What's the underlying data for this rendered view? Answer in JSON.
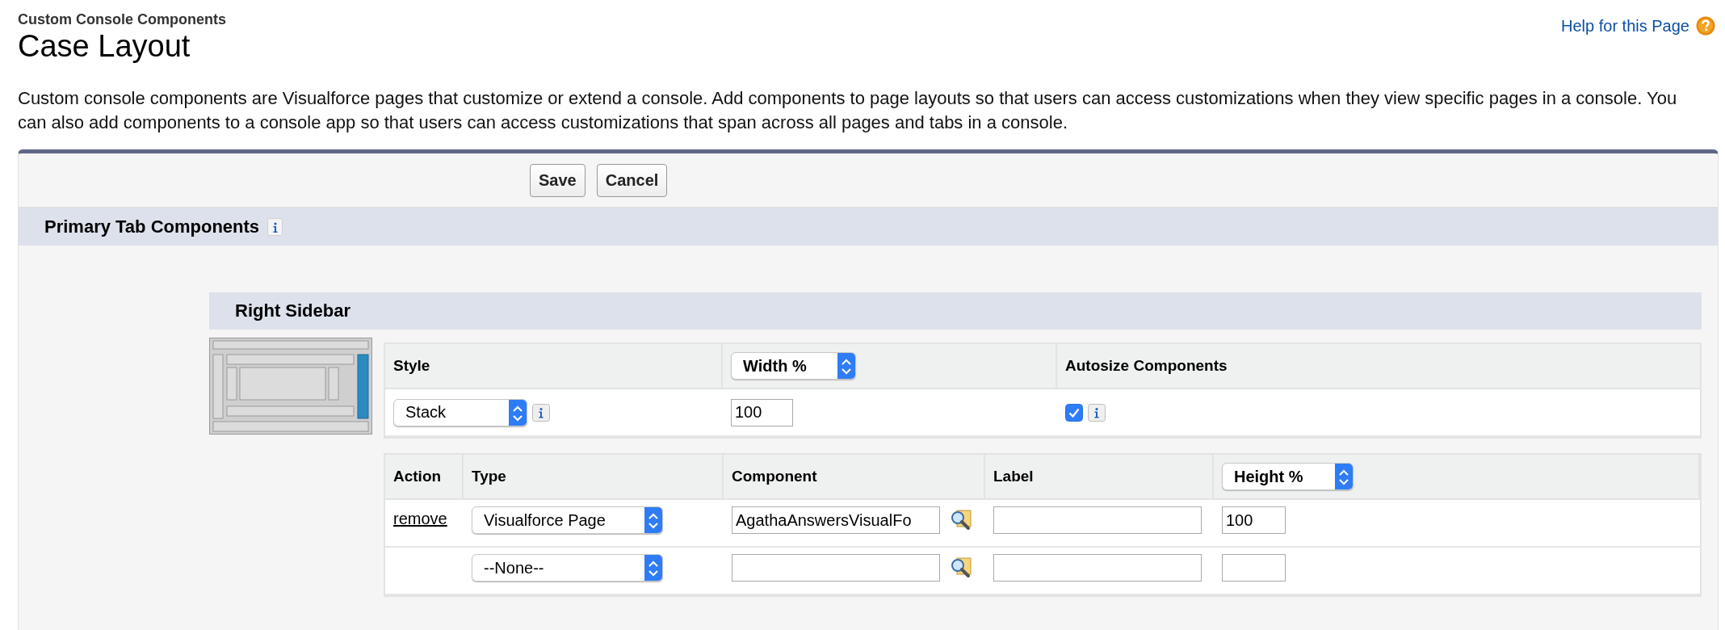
{
  "header": {
    "breadcrumb": "Custom Console Components",
    "title": "Case Layout",
    "help_link": "Help for this Page"
  },
  "description": "Custom console components are Visualforce pages that customize or extend a console. Add components to page layouts so that users can access customizations when they view specific pages in a console. You can also add components to a console app so that users can access customizations that span across all pages and tabs in a console.",
  "buttons": [
    "Save",
    "Cancel"
  ],
  "section": {
    "title": "Primary Tab Components"
  },
  "subsection": {
    "title": "Right Sidebar"
  },
  "settings": {
    "style_label": "Style",
    "style_value": "Stack",
    "width_unit": "Width %",
    "width_value": "100",
    "autosize_label": "Autosize Components",
    "autosize_checked": true
  },
  "components": {
    "columns": [
      "Action",
      "Type",
      "Component",
      "Label"
    ],
    "size_unit": "Height %",
    "rows": [
      {
        "action": "remove",
        "type": "Visualforce Page",
        "component": "AgathaAnswersVisualFo",
        "size": "100"
      },
      {
        "type": "--None--"
      }
    ]
  }
}
